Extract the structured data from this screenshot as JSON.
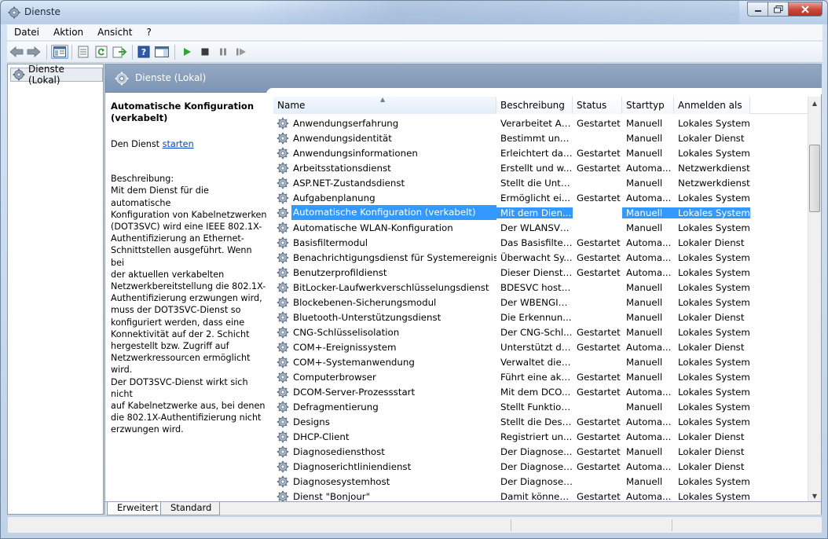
{
  "window": {
    "title": "Dienste"
  },
  "menu": {
    "file": "Datei",
    "action": "Aktion",
    "view": "Ansicht",
    "help": "?"
  },
  "tree": {
    "root": "Dienste (Lokal)"
  },
  "pane_header": "Dienste (Lokal)",
  "detail": {
    "title_line1": "Automatische Konfiguration",
    "title_line2": "(verkabelt)",
    "start_prefix": "Den Dienst ",
    "start_link": "starten",
    "desc_label": "Beschreibung:",
    "desc_lines": [
      "Mit dem Dienst für die automatische",
      "Konfiguration von Kabelnetzwerken",
      "(DOT3SVC) wird eine IEEE 802.1X-",
      "Authentifizierung an Ethernet-",
      "Schnittstellen ausgeführt. Wenn bei",
      "der aktuellen verkabelten",
      "Netzwerkbereitstellung die 802.1X-",
      "Authentifizierung erzwungen wird,",
      "muss der DOT3SVC-Dienst so",
      "konfiguriert werden, dass eine",
      "Konnektivität auf der 2. Schicht",
      "hergestellt bzw. Zugriff auf",
      "Netzwerkressourcen ermöglicht wird.",
      "Der DOT3SVC-Dienst wirkt sich nicht",
      "auf Kabelnetzwerke aus, bei denen",
      "die 802.1X-Authentifizierung nicht",
      "erzwungen wird."
    ]
  },
  "columns": {
    "name": "Name",
    "description": "Beschreibung",
    "status": "Status",
    "startup": "Starttyp",
    "logon": "Anmelden als"
  },
  "services": [
    {
      "name": "Anwendungserfahrung",
      "description": "Verarbeitet An...",
      "status": "Gestartet",
      "startup": "Manuell",
      "logon": "Lokales System"
    },
    {
      "name": "Anwendungsidentität",
      "description": "Bestimmt und ...",
      "status": "",
      "startup": "Manuell",
      "logon": "Lokaler Dienst"
    },
    {
      "name": "Anwendungsinformationen",
      "description": "Erleichtert das...",
      "status": "Gestartet",
      "startup": "Manuell",
      "logon": "Lokales System"
    },
    {
      "name": "Arbeitsstationsdienst",
      "description": "Erstellt und w...",
      "status": "Gestartet",
      "startup": "Automa...",
      "logon": "Netzwerkdienst"
    },
    {
      "name": "ASP.NET-Zustandsdienst",
      "description": "Stellt die Unte...",
      "status": "",
      "startup": "Manuell",
      "logon": "Netzwerkdienst"
    },
    {
      "name": "Aufgabenplanung",
      "description": "Ermöglicht ei...",
      "status": "Gestartet",
      "startup": "Automa...",
      "logon": "Lokales System"
    },
    {
      "name": "Automatische Konfiguration (verkabelt)",
      "description": "Mit dem Dien...",
      "status": "",
      "startup": "Manuell",
      "logon": "Lokales System",
      "selected": true
    },
    {
      "name": "Automatische WLAN-Konfiguration",
      "description": "Der WLANSVC...",
      "status": "",
      "startup": "Manuell",
      "logon": "Lokales System"
    },
    {
      "name": "Basisfiltermodul",
      "description": "Das Basisfilter...",
      "status": "Gestartet",
      "startup": "Automa...",
      "logon": "Lokaler Dienst"
    },
    {
      "name": "Benachrichtigungsdienst für Systemereignisse",
      "description": "Überwacht Sy...",
      "status": "Gestartet",
      "startup": "Automa...",
      "logon": "Lokales System"
    },
    {
      "name": "Benutzerprofildienst",
      "description": "Dieser Dienst i...",
      "status": "Gestartet",
      "startup": "Automa...",
      "logon": "Lokales System"
    },
    {
      "name": "BitLocker-Laufwerkverschlüsselungsdienst",
      "description": "BDESVC hoste...",
      "status": "",
      "startup": "Manuell",
      "logon": "Lokales System"
    },
    {
      "name": "Blockebenen-Sicherungsmodul",
      "description": "Der WBENGIN...",
      "status": "",
      "startup": "Manuell",
      "logon": "Lokales System"
    },
    {
      "name": "Bluetooth-Unterstützungsdienst",
      "description": "Die Erkennun...",
      "status": "",
      "startup": "Manuell",
      "logon": "Lokaler Dienst"
    },
    {
      "name": "CNG-Schlüsselisolation",
      "description": "Der CNG-Schl...",
      "status": "Gestartet",
      "startup": "Manuell",
      "logon": "Lokales System"
    },
    {
      "name": "COM+-Ereignissystem",
      "description": "Unterstützt de...",
      "status": "Gestartet",
      "startup": "Automa...",
      "logon": "Lokaler Dienst"
    },
    {
      "name": "COM+-Systemanwendung",
      "description": "Verwaltet die ...",
      "status": "",
      "startup": "Manuell",
      "logon": "Lokales System"
    },
    {
      "name": "Computerbrowser",
      "description": "Führt eine akt...",
      "status": "Gestartet",
      "startup": "Manuell",
      "logon": "Lokales System"
    },
    {
      "name": "DCOM-Server-Prozessstart",
      "description": "Mit dem DCO...",
      "status": "Gestartet",
      "startup": "Automa...",
      "logon": "Lokales System"
    },
    {
      "name": "Defragmentierung",
      "description": "Stellt Funktion...",
      "status": "",
      "startup": "Manuell",
      "logon": "Lokales System"
    },
    {
      "name": "Designs",
      "description": "Stellt die Desi...",
      "status": "Gestartet",
      "startup": "Automa...",
      "logon": "Lokales System"
    },
    {
      "name": "DHCP-Client",
      "description": "Registriert un...",
      "status": "Gestartet",
      "startup": "Automa...",
      "logon": "Lokaler Dienst"
    },
    {
      "name": "Diagnosediensthost",
      "description": "Der Diagnose...",
      "status": "Gestartet",
      "startup": "Manuell",
      "logon": "Lokaler Dienst"
    },
    {
      "name": "Diagnoserichtliniendienst",
      "description": "Der Diagnoser...",
      "status": "Gestartet",
      "startup": "Automa...",
      "logon": "Lokaler Dienst"
    },
    {
      "name": "Diagnosesystemhost",
      "description": "Der Diagnoses...",
      "status": "",
      "startup": "Manuell",
      "logon": "Lokales System"
    },
    {
      "name": "Dienst \"Bonjour\"",
      "description": "Damit können...",
      "status": "Gestartet",
      "startup": "Automa...",
      "logon": "Lokales System"
    }
  ],
  "tabs": {
    "extended": "Erweitert",
    "standard": "Standard"
  }
}
